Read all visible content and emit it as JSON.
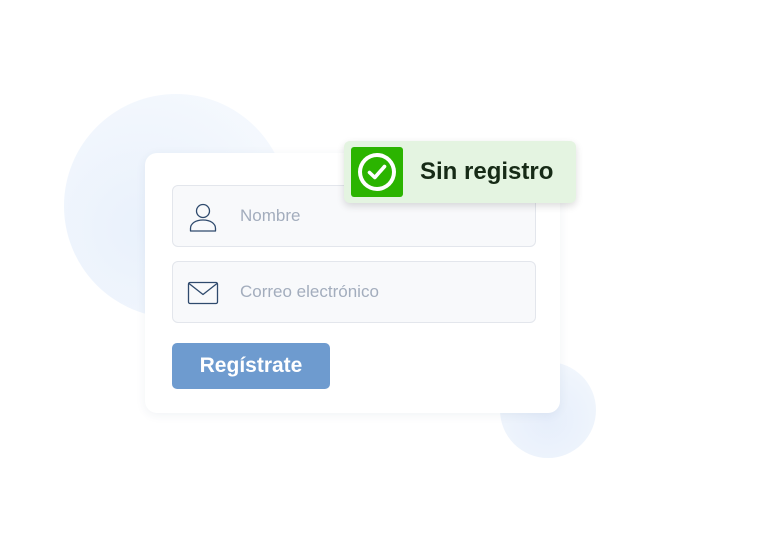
{
  "form": {
    "name_field": {
      "placeholder": "Nombre",
      "icon": "user-icon"
    },
    "email_field": {
      "placeholder": "Correo electrónico",
      "icon": "envelope-icon"
    },
    "submit_label": "Regístrate"
  },
  "badge": {
    "label": "Sin registro",
    "icon": "check-circle-icon"
  },
  "colors": {
    "button": "#6e9bcf",
    "badge_background": "#e4f4e1",
    "badge_check": "#2bb400",
    "placeholder_text": "#a3adbd",
    "icon_stroke": "#2f4a6d"
  }
}
